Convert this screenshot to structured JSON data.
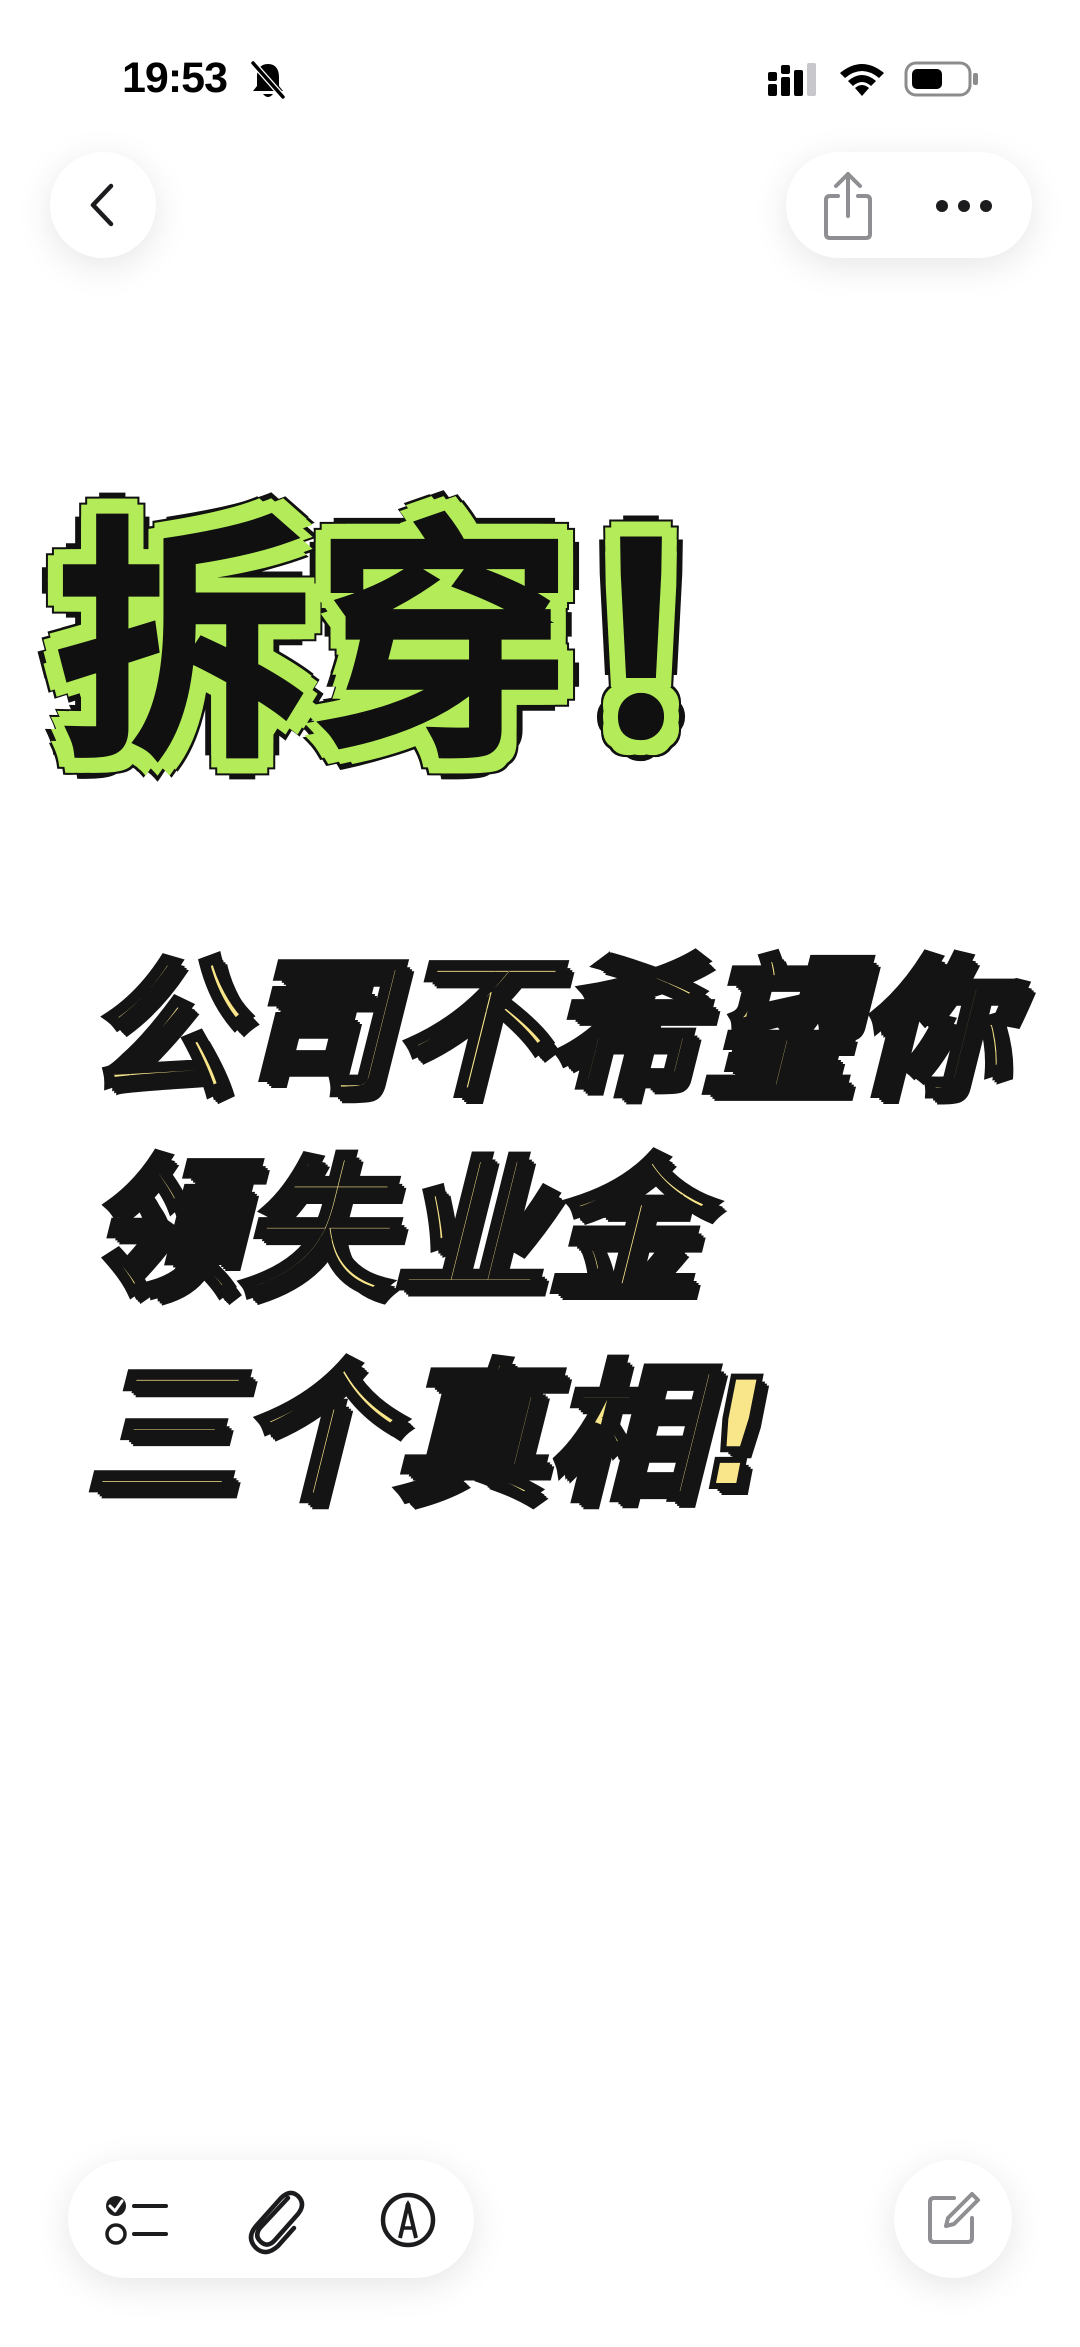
{
  "status_bar": {
    "time": "19:53",
    "icons": [
      "bell-off-icon",
      "cellular-signal-icon",
      "wifi-icon",
      "battery-icon"
    ]
  },
  "toolbar_top": {
    "back_icon": "chevron-left-icon",
    "share_icon": "share-icon",
    "more_icon": "more-horizontal-icon"
  },
  "note": {
    "headline": "拆穿！",
    "subtitle_lines": [
      "公司不希望你",
      "领失业金",
      "三个真相!"
    ]
  },
  "toolbar_bottom": {
    "icons": [
      "checklist-icon",
      "paperclip-icon",
      "markup-pen-icon",
      "compose-icon"
    ]
  },
  "colors": {
    "headline_fill": "#101010",
    "headline_glow": "#b3ec58",
    "subtitle_fill": "#f9e58a",
    "outline": "#141414",
    "icon_gray": "#8e8e93"
  }
}
